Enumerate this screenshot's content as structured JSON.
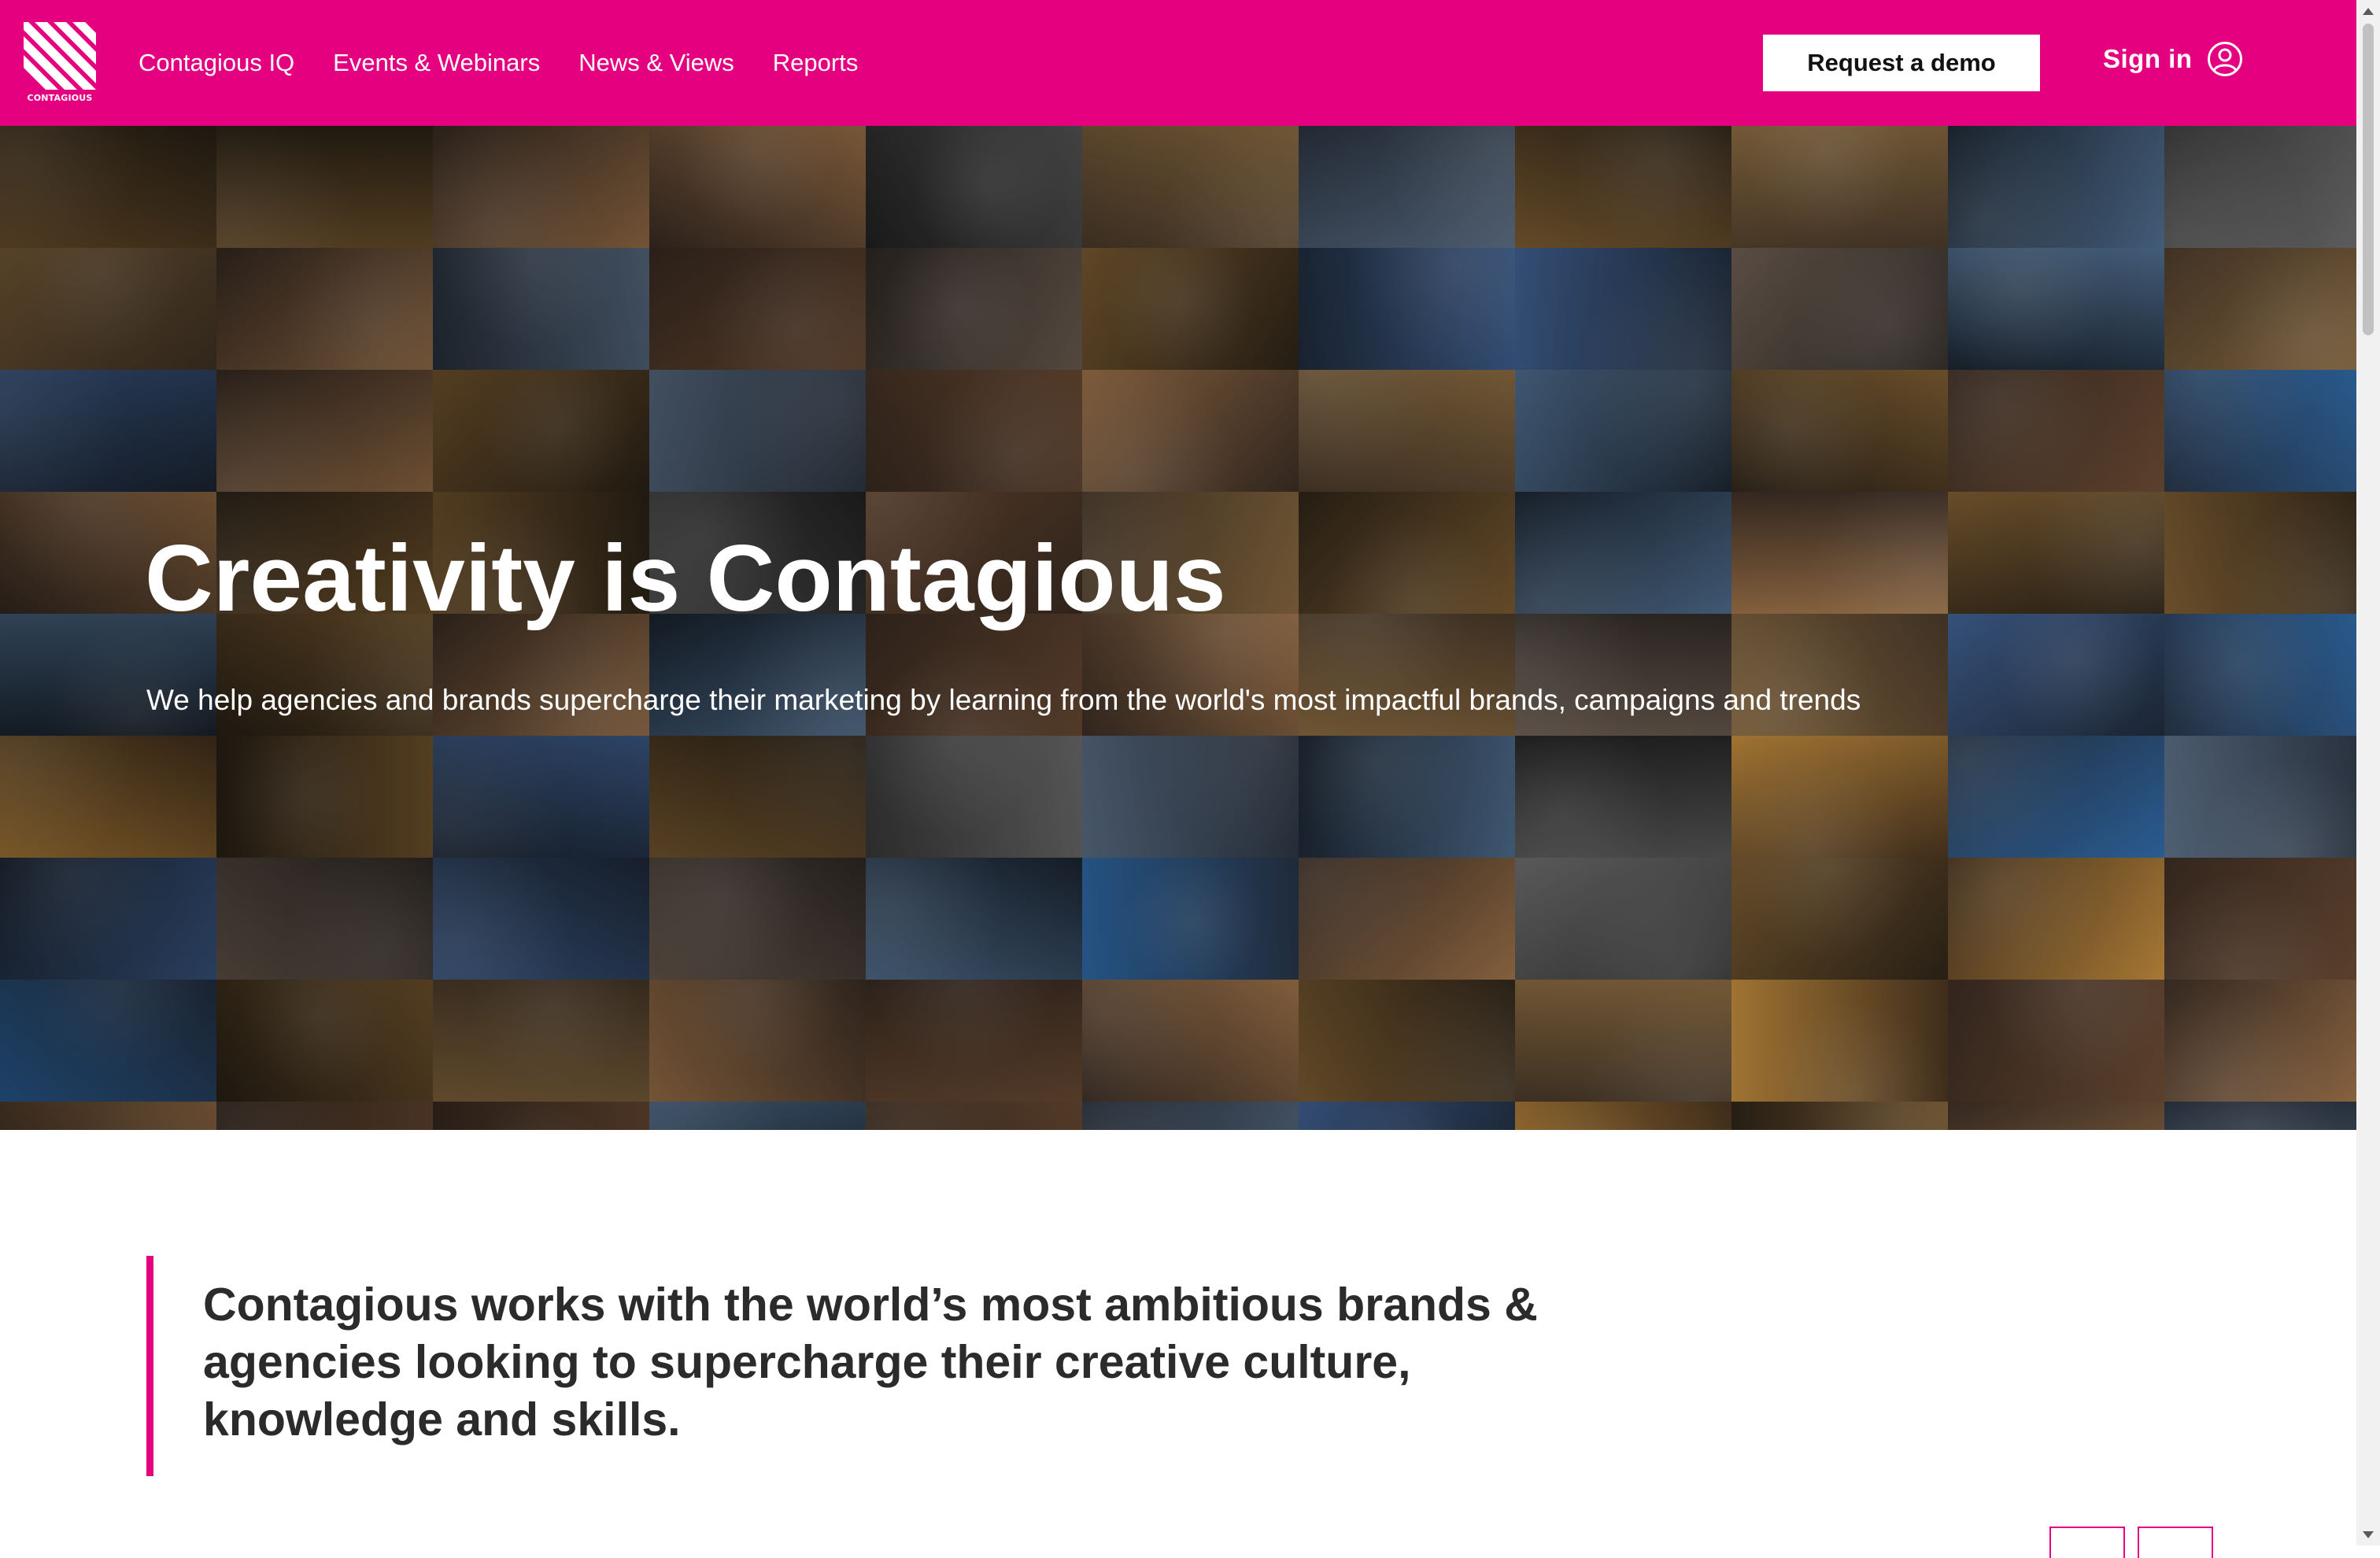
{
  "brand": {
    "logo_text": "CONTAGIOUS",
    "primary_color": "#e4007f"
  },
  "nav": {
    "items": [
      {
        "label": "Contagious IQ"
      },
      {
        "label": "Events & Webinars"
      },
      {
        "label": "News & Views"
      },
      {
        "label": "Reports"
      }
    ]
  },
  "header": {
    "demo_label": "Request a demo",
    "signin_label": "Sign in",
    "signin_icon": "user-circle-icon"
  },
  "hero": {
    "title": "Creativity is Contagious",
    "subtitle": "We help agencies and brands supercharge their marketing by learning from the world's most impactful brands, campaigns and trends"
  },
  "intro": {
    "text": "Contagious works with the world’s most ambitious brands & agencies looking to supercharge their creative culture, knowledge and skills."
  },
  "carousel": {
    "prev_icon": "arrow-left-icon",
    "next_icon": "arrow-right-icon"
  }
}
